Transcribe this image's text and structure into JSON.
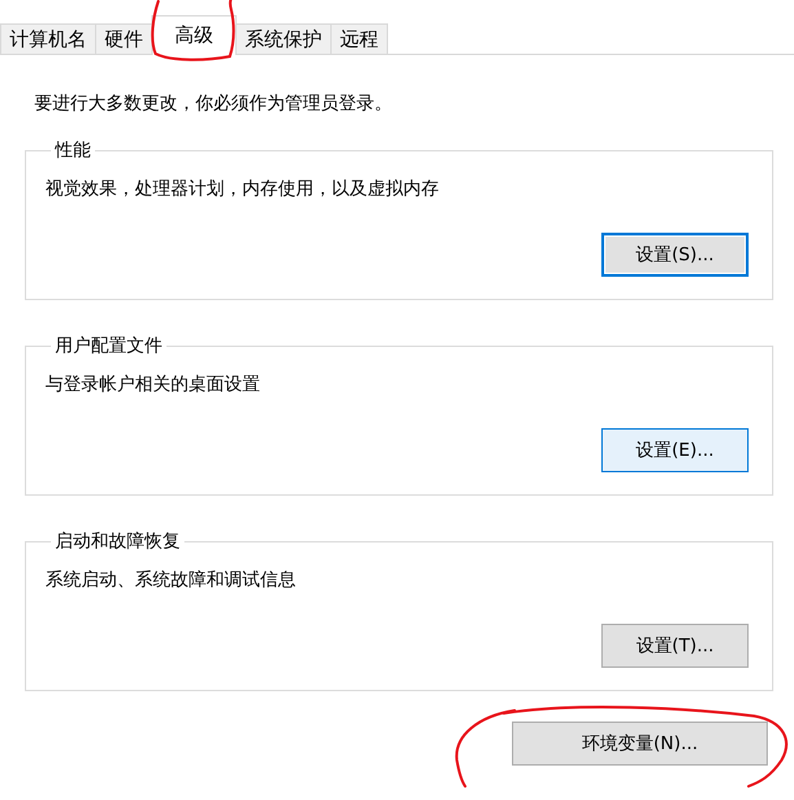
{
  "tabs": [
    {
      "label": "计算机名",
      "selected": false
    },
    {
      "label": "硬件",
      "selected": false
    },
    {
      "label": "高级",
      "selected": true,
      "circled": true
    },
    {
      "label": "系统保护",
      "selected": false
    },
    {
      "label": "远程",
      "selected": false
    }
  ],
  "notice": "要进行大多数更改，你必须作为管理员登录。",
  "groups": [
    {
      "title": "性能",
      "description": "视觉效果，处理器计划，内存使用，以及虚拟内存",
      "button": {
        "label": "设置(S)...",
        "focused": true,
        "hovered": false
      }
    },
    {
      "title": "用户配置文件",
      "description": "与登录帐户相关的桌面设置",
      "button": {
        "label": "设置(E)...",
        "focused": false,
        "hovered": true
      }
    },
    {
      "title": "启动和故障恢复",
      "description": "系统启动、系统故障和调试信息",
      "button": {
        "label": "设置(T)...",
        "focused": false,
        "hovered": false
      }
    }
  ],
  "env_button": {
    "label": "环境变量(N)...",
    "focused": false,
    "hovered": false,
    "circled": true
  }
}
